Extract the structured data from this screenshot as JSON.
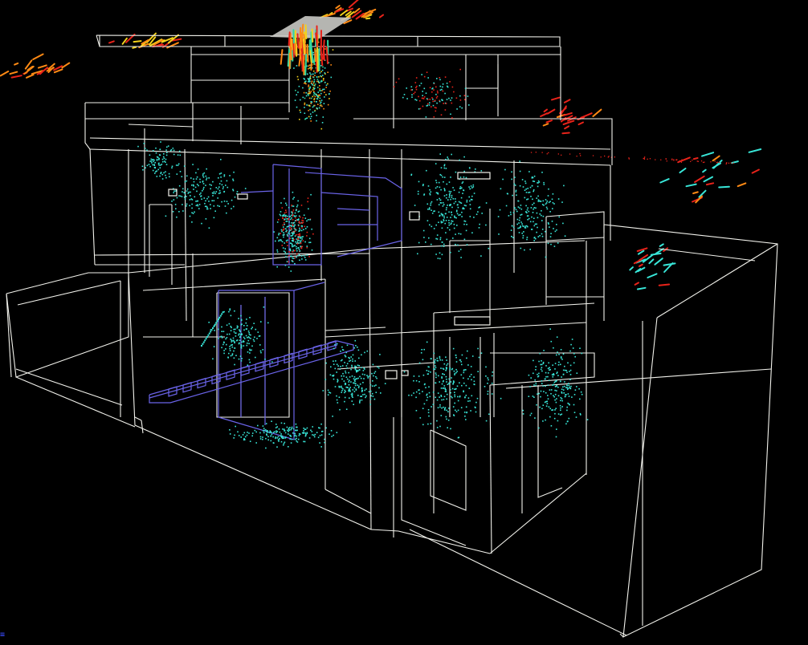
{
  "view": {
    "background_color": "#000000",
    "wireframe_color": "#f2f2ec",
    "duct_color": "#6a63e8",
    "ceiling_fill_color": "#c9c9c4"
  },
  "velocity_color_scale": {
    "low": "#38e6d8",
    "mid_low": "#2fd9a0",
    "mid": "#f3d21c",
    "mid_high": "#ff8a14",
    "high": "#e8231a"
  },
  "particle_seed": 20240
}
